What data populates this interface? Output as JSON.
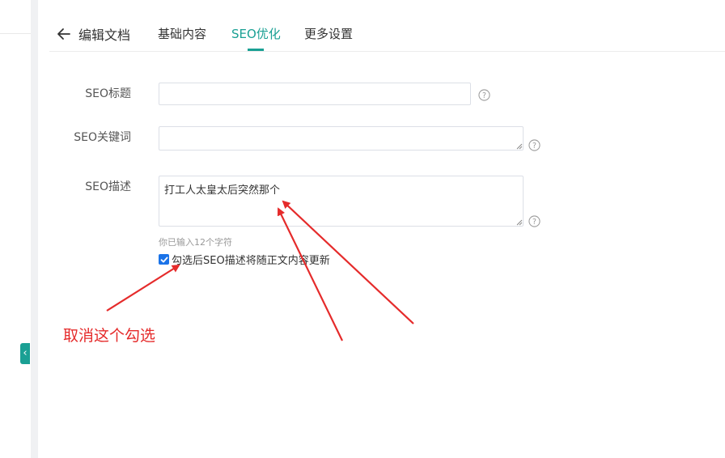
{
  "header": {
    "back_label": "编辑文档",
    "tabs": [
      {
        "label": "基础内容"
      },
      {
        "label": "SEO优化"
      },
      {
        "label": "更多设置"
      }
    ],
    "active_tab": "SEO优化"
  },
  "form": {
    "seo_title_label": "SEO标题",
    "seo_title_value": "",
    "seo_keywords_label": "SEO关键词",
    "seo_keywords_value": "",
    "seo_desc_label": "SEO描述",
    "seo_desc_value": "打工人太皇太后突然那个",
    "char_count": "你已输入12个字符",
    "auto_update_label": "勾选后SEO描述将随正文内容更新",
    "auto_update_checked": true
  },
  "annotation": {
    "text": "取消这个勾选",
    "color": "#e52b2b"
  },
  "colors": {
    "accent": "#1aa094",
    "checkbox": "#1a73e8"
  },
  "icons": {
    "back": "arrow-left-icon",
    "help": "question-circle-icon",
    "sidebar_toggle": "chevron-left-icon"
  }
}
